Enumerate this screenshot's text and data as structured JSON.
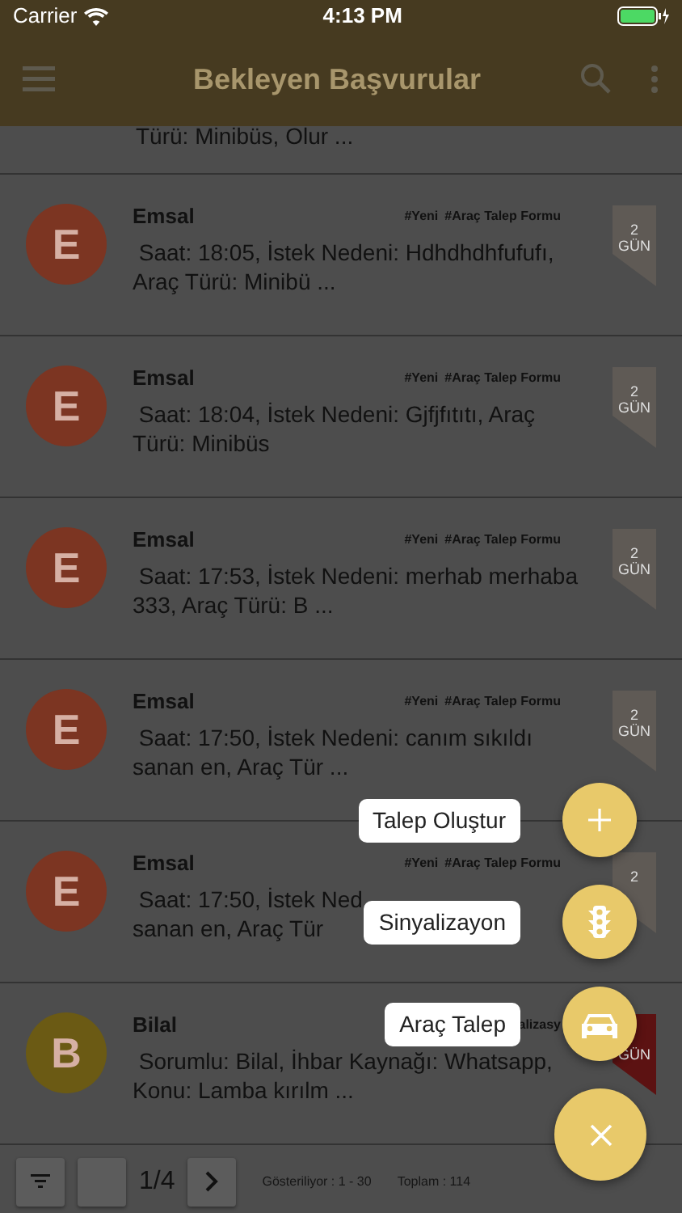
{
  "status_bar": {
    "carrier": "Carrier",
    "time": "4:13 PM"
  },
  "navbar": {
    "title": "Bekleyen Başvurular"
  },
  "partial_row": {
    "body": "Türü: Minibüs, Olur ..."
  },
  "rows": [
    {
      "initial": "E",
      "color": "#7c3522",
      "name": "Emsal",
      "tags": [
        "#Yeni",
        "#Araç Talep Formu"
      ],
      "lines": [
        "Saat: 18:05, İstek Nedeni: Hdhdhdhfufufı,",
        "Araç Türü: Minibü ..."
      ],
      "ribbon": {
        "days": "2",
        "unit": "GÜN",
        "color": "#5f5a55"
      }
    },
    {
      "initial": "E",
      "color": "#7c3522",
      "name": "Emsal",
      "tags": [
        "#Yeni",
        "#Araç Talep Formu"
      ],
      "lines": [
        "Saat: 18:04, İstek Nedeni: Gjfjfıtıtı, Araç",
        "Türü: Minibüs"
      ],
      "ribbon": {
        "days": "2",
        "unit": "GÜN",
        "color": "#5f5a55"
      }
    },
    {
      "initial": "E",
      "color": "#7c3522",
      "name": "Emsal",
      "tags": [
        "#Yeni",
        "#Araç Talep Formu"
      ],
      "lines": [
        "Saat: 17:53, İstek Nedeni: merhab merhaba",
        "333, Araç Türü: B ..."
      ],
      "ribbon": {
        "days": "2",
        "unit": "GÜN",
        "color": "#5f5a55"
      }
    },
    {
      "initial": "E",
      "color": "#7c3522",
      "name": "Emsal",
      "tags": [
        "#Yeni",
        "#Araç Talep Formu"
      ],
      "lines": [
        "Saat: 17:50, İstek Nedeni: canım sıkıldı",
        "sanan en, Araç Tür ..."
      ],
      "ribbon": {
        "days": "2",
        "unit": "GÜN",
        "color": "#5f5a55"
      }
    },
    {
      "initial": "E",
      "color": "#7c3522",
      "name": "Emsal",
      "tags": [
        "#Yeni",
        "#Araç Talep Formu"
      ],
      "lines": [
        "Saat: 17:50, İstek Ned",
        "sanan en, Araç Tür"
      ],
      "ribbon": {
        "days": "2",
        "color": "#5f5a55"
      }
    },
    {
      "initial": "B",
      "color": "#6b5a14",
      "name": "Bilal",
      "tags": [
        "alizasy"
      ],
      "lines": [
        "Sorumlu: Bilal, İhbar Kaynağı: Whatsapp,",
        "Konu: Lamba kırılm ..."
      ],
      "ribbon": {
        "unit": "GÜN",
        "color": "#5c1212"
      }
    }
  ],
  "footer": {
    "page": "1/4",
    "showing": "Gösteriliyor : 1 - 30",
    "total": "Toplam : 114"
  },
  "fab_actions": [
    {
      "kind": "add",
      "label": "Talep Oluştur"
    },
    {
      "kind": "traffic",
      "label": "Sinyalizayon"
    },
    {
      "kind": "car",
      "label": "Araç Talep"
    }
  ]
}
